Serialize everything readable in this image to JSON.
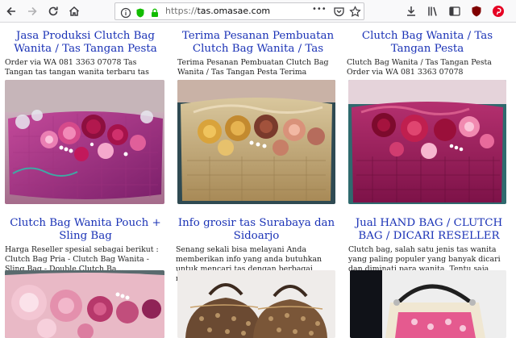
{
  "browser": {
    "url_scheme": "https://",
    "url_host": "tas.omasae.com",
    "menu_dots": "•••"
  },
  "posts": [
    {
      "title": "Jasa Produksi Clutch Bag Wanita / Tas Tangan Pesta",
      "excerpt": "Order via WA 081 3363 07078 Tas Tangan tas tangan wanita terbaru tas"
    },
    {
      "title": "Terima Pesanan Pembuatan Clutch Bag Wanita / Tas",
      "excerpt": "Terima Pesanan Pembuatan Clutch Bag Wanita / Tas Tangan Pesta Terima"
    },
    {
      "title": "Clutch Bag Wanita / Tas Tangan Pesta",
      "excerpt": "Clutch Bag Wanita / Tas Tangan Pesta Order via WA 081 3363 07078"
    },
    {
      "title": "Clutch Bag Wanita Pouch + Sling Bag",
      "excerpt": "Harga Reseller spesial sebagai berikut : Clutch Bag Pria - Clutch Bag Wanita - Sling Bag - Double Clutch Ba..."
    },
    {
      "title": "Info grosir tas Surabaya dan Sidoarjo",
      "excerpt": "Senang sekali bisa melayani Anda memberikan info yang anda butuhkan untuk mencari tas dengan berbagai model dengan harga sangat murah."
    },
    {
      "title": "Jual HAND BAG / CLUTCH BAG / DICARI RESELLER",
      "excerpt": "Clutch bag, salah satu jenis tas wanita yang paling populer yang banyak dicari dan diminati para wanita. Tentu saja"
    }
  ]
}
